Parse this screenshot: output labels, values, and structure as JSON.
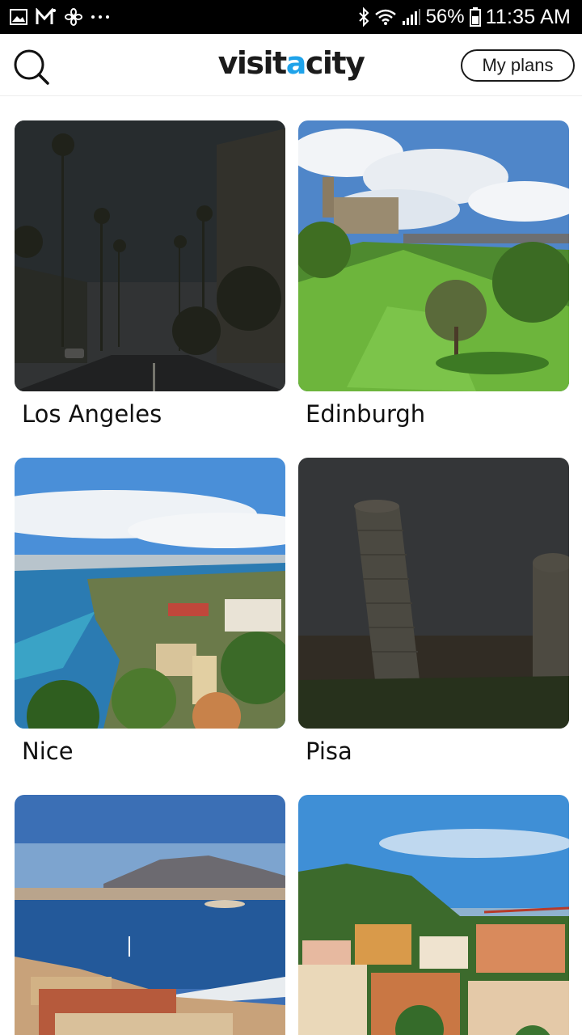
{
  "status_bar": {
    "battery": "56%",
    "time": "11:35 AM",
    "left_icons": [
      "gallery-icon",
      "gmail-icon",
      "fan-icon",
      "more-dots-icon"
    ],
    "right_icons": [
      "bluetooth-icon",
      "wifi-icon",
      "signal-icon",
      "battery-icon"
    ]
  },
  "header": {
    "logo_prefix": "visit",
    "logo_accent": "a",
    "logo_suffix": "city",
    "accent_color": "#1fa3ea",
    "my_plans_label": "My plans",
    "search_icon": "search-icon"
  },
  "cities": [
    {
      "name": "Los Angeles",
      "dimmed": true
    },
    {
      "name": "Edinburgh",
      "dimmed": false
    },
    {
      "name": "Nice",
      "dimmed": false
    },
    {
      "name": "Pisa",
      "dimmed": true
    },
    {
      "name": "",
      "dimmed": false
    },
    {
      "name": "",
      "dimmed": false
    }
  ]
}
